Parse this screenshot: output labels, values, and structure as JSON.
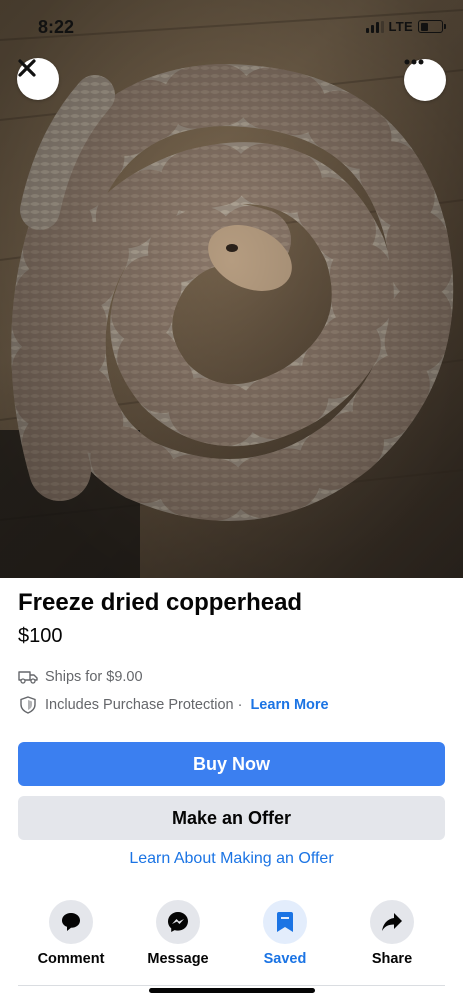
{
  "status_bar": {
    "time": "8:22",
    "network": "LTE",
    "signal_bars": 3,
    "battery_level": 0.35
  },
  "hero": {
    "close_icon": "close-icon",
    "more_icon": "more-horizontal-icon"
  },
  "listing": {
    "title": "Freeze dried copperhead",
    "price": "$100",
    "shipping": "Ships for $9.00",
    "protection": "Includes Purchase Protection",
    "separator": "·",
    "learn_more": "Learn More"
  },
  "buttons": {
    "buy_now": "Buy Now",
    "make_offer": "Make an Offer",
    "learn_offer": "Learn About Making an Offer"
  },
  "actions": [
    {
      "label": "Comment",
      "icon": "comment-icon"
    },
    {
      "label": "Message",
      "icon": "messenger-icon"
    },
    {
      "label": "Saved",
      "icon": "bookmark-icon"
    },
    {
      "label": "Share",
      "icon": "share-icon"
    }
  ],
  "colors": {
    "accent": "#1b74e4",
    "buy_button": "#3b7ff0",
    "secondary_button": "#e4e6eb"
  }
}
